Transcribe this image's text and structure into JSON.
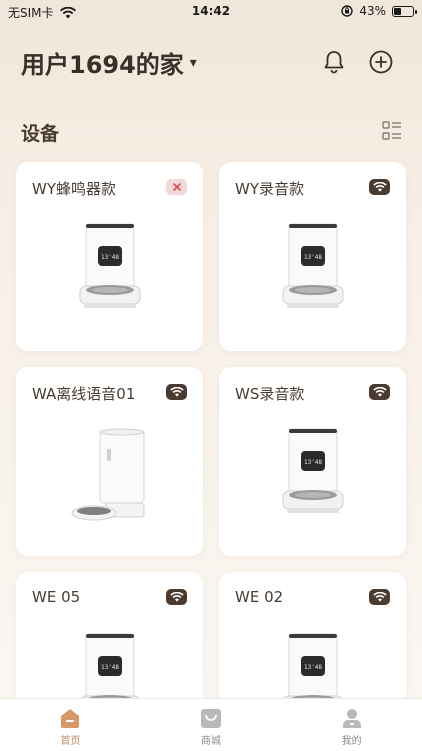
{
  "status_bar": {
    "carrier": "无SIM卡",
    "time": "14:42",
    "battery": "43%",
    "battery_level": 0.43
  },
  "header": {
    "home_name": "用户1694的家",
    "caret": "▾"
  },
  "section": {
    "title": "设备"
  },
  "devices": [
    {
      "name": "WY蜂鸣器款",
      "status": "offline",
      "model": "standard"
    },
    {
      "name": "WY录音款",
      "status": "online",
      "model": "standard"
    },
    {
      "name": "WA离线语音01",
      "status": "online",
      "model": "tall"
    },
    {
      "name": "WS录音款",
      "status": "online",
      "model": "standard"
    },
    {
      "name": "WE 05",
      "status": "online",
      "model": "standard"
    },
    {
      "name": "WE 02",
      "status": "online",
      "model": "standard"
    }
  ],
  "device_screen_text": "13'48",
  "tabs": [
    {
      "label": "首页",
      "icon": "home-icon",
      "active": true
    },
    {
      "label": "商城",
      "icon": "shop-bag-icon",
      "active": false
    },
    {
      "label": "我的",
      "icon": "profile-icon",
      "active": false
    }
  ],
  "colors": {
    "accent": "#c48b5c",
    "dark": "#4a3b31",
    "offline_bg": "#f0d9d9",
    "offline_x": "#e04a4a"
  }
}
